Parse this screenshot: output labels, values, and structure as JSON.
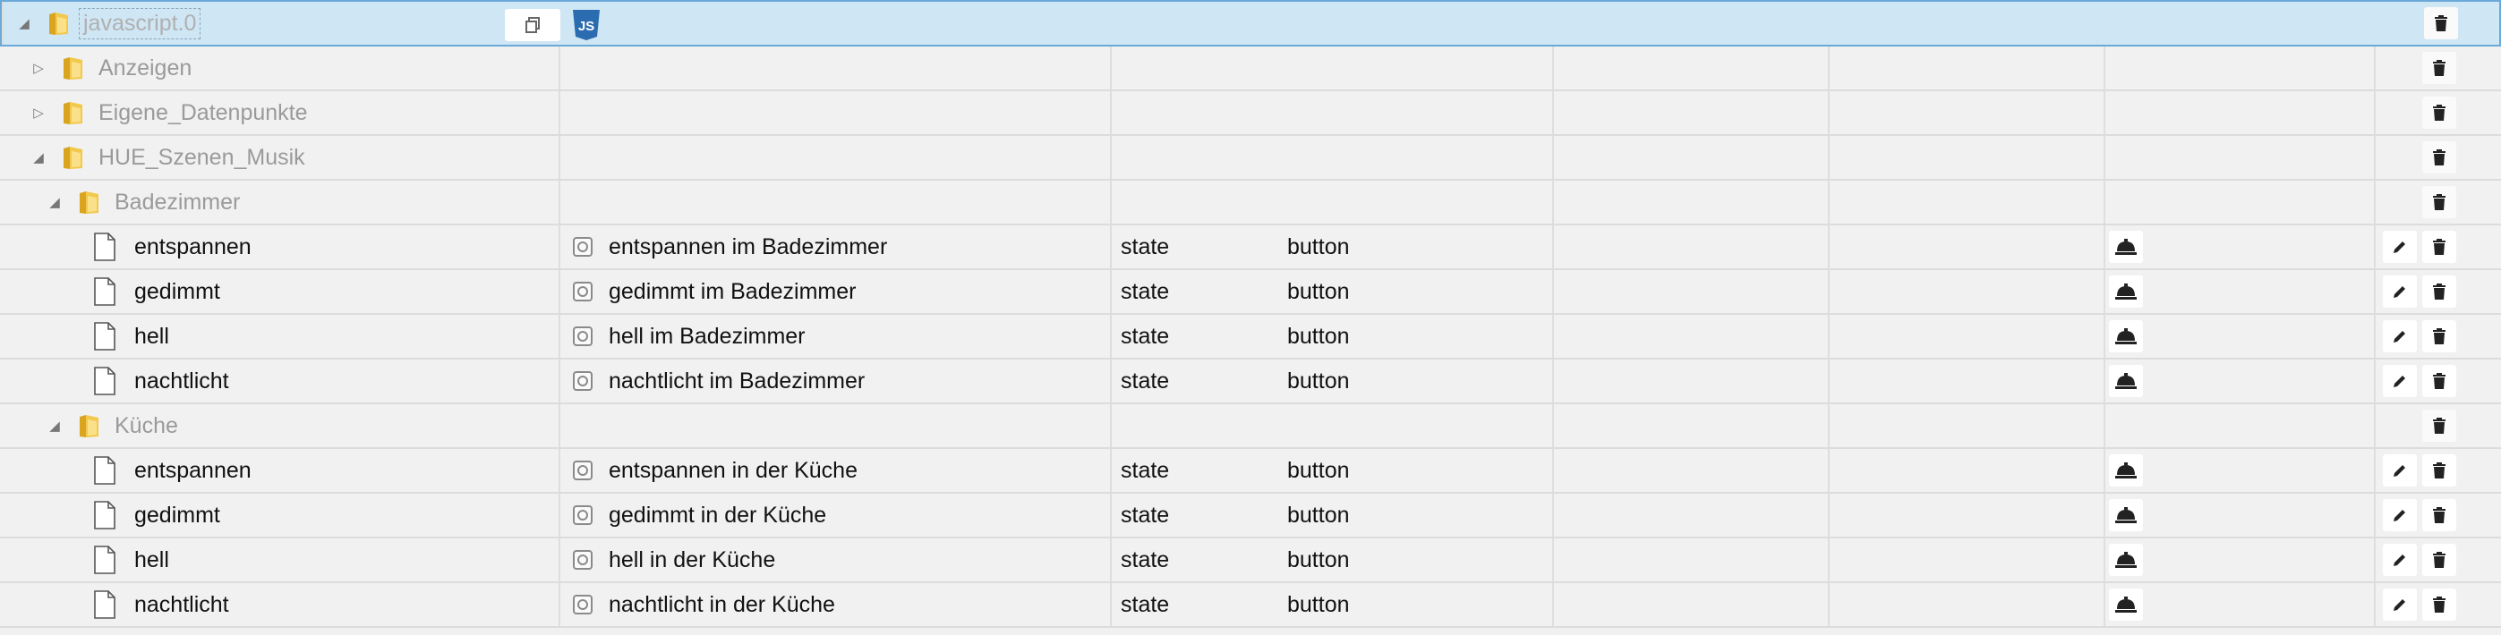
{
  "tree": {
    "root": {
      "name": "javascript.0"
    },
    "rows": [
      {
        "level": 1,
        "type": "folder",
        "expanded": false,
        "name": "Anzeigen"
      },
      {
        "level": 1,
        "type": "folder",
        "expanded": false,
        "name": "Eigene_Datenpunkte"
      },
      {
        "level": 1,
        "type": "folder",
        "expanded": true,
        "name": "HUE_Szenen_Musik"
      },
      {
        "level": 2,
        "type": "folder",
        "expanded": true,
        "name": "Badezimmer"
      },
      {
        "level": 3,
        "type": "state",
        "name": "entspannen",
        "desc": "entspannen im Badezimmer",
        "kind": "state",
        "role": "button"
      },
      {
        "level": 3,
        "type": "state",
        "name": "gedimmt",
        "desc": "gedimmt im Badezimmer",
        "kind": "state",
        "role": "button"
      },
      {
        "level": 3,
        "type": "state",
        "name": "hell",
        "desc": "hell im Badezimmer",
        "kind": "state",
        "role": "button"
      },
      {
        "level": 3,
        "type": "state",
        "name": "nachtlicht",
        "desc": "nachtlicht im Badezimmer",
        "kind": "state",
        "role": "button"
      },
      {
        "level": 2,
        "type": "folder",
        "expanded": true,
        "name": "Küche"
      },
      {
        "level": 3,
        "type": "state",
        "name": "entspannen",
        "desc": "entspannen in der Küche",
        "kind": "state",
        "role": "button"
      },
      {
        "level": 3,
        "type": "state",
        "name": "gedimmt",
        "desc": "gedimmt in der Küche",
        "kind": "state",
        "role": "button"
      },
      {
        "level": 3,
        "type": "state",
        "name": "hell",
        "desc": "hell in der Küche",
        "kind": "state",
        "role": "button"
      },
      {
        "level": 3,
        "type": "state",
        "name": "nachtlicht",
        "desc": "nachtlicht in der Küche",
        "kind": "state",
        "role": "button"
      }
    ]
  },
  "icons": {
    "copy": "copy-icon",
    "js": "js-badge-icon",
    "bell": "bell-icon",
    "edit": "pencil-icon",
    "delete": "trash-icon",
    "folder": "folder-icon",
    "file": "file-icon"
  },
  "colors": {
    "selected_bg": "#cfe6f5",
    "selected_border": "#6aa9d8",
    "js_badge": "#2b6cb0"
  }
}
